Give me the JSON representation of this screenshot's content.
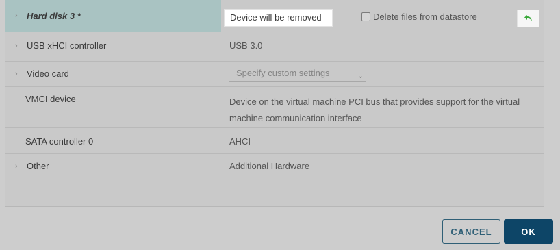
{
  "hard_disk": {
    "label": "Hard disk 3 *",
    "status": "Device will be removed",
    "delete_label": "Delete files from datastore",
    "delete_checked": false,
    "undo_icon": "undo-arrow-icon",
    "highlight_color": "#a9c3c2",
    "undo_color": "#3aa83a"
  },
  "rows": {
    "usb": {
      "label": "USB xHCI controller",
      "value": "USB 3.0"
    },
    "video": {
      "label": "Video card",
      "value": "Specify custom settings"
    },
    "vmci": {
      "label": "VMCI device",
      "value": "Device on the virtual machine PCI bus that provides support for the virtual machine communication interface"
    },
    "sata": {
      "label": "SATA controller 0",
      "value": "AHCI"
    },
    "other": {
      "label": "Other",
      "value": "Additional Hardware"
    }
  },
  "footer": {
    "cancel_label": "CANCEL",
    "ok_label": "OK",
    "primary_color": "#0d4567"
  }
}
